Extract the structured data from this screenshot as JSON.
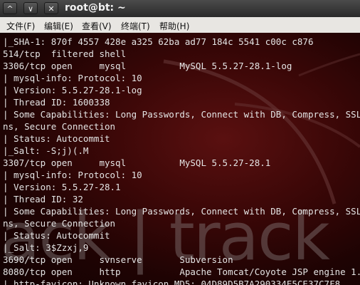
{
  "titlebar": {
    "title": "root@bt: ~",
    "buttons": [
      {
        "name": "scroll-up-button",
        "glyph": "^"
      },
      {
        "name": "minimize-button",
        "glyph": "∨"
      },
      {
        "name": "close-button",
        "glyph": "✕"
      }
    ]
  },
  "menubar": {
    "items": [
      "文件(F)",
      "编辑(E)",
      "查看(V)",
      "终端(T)",
      "帮助(H)"
    ]
  },
  "background": {
    "watermark": "ack | track"
  },
  "terminal": {
    "lines": [
      "|_SHA-1: 870f 4557 428e a325 62ba ad77 184c 5541 c00c c876",
      "514/tcp  filtered shell",
      "3306/tcp open     mysql          MySQL 5.5.27-28.1-log",
      "| mysql-info: Protocol: 10",
      "| Version: 5.5.27-28.1-log",
      "| Thread ID: 1600338",
      "| Some Capabilities: Long Passwords, Connect with DB, Compress, SSL, Transactio",
      "ns, Secure Connection",
      "| Status: Autocommit",
      "|_Salt: -S;j)(.M",
      "3307/tcp open     mysql          MySQL 5.5.27-28.1",
      "| mysql-info: Protocol: 10",
      "| Version: 5.5.27-28.1",
      "| Thread ID: 32",
      "| Some Capabilities: Long Passwords, Connect with DB, Compress, SSL, Transactio",
      "ns, Secure Connection",
      "| Status: Autocommit",
      "|_Salt: 3$Zzxj,9",
      "3690/tcp open     svnserve       Subversion",
      "8080/tcp open     http           Apache Tomcat/Coyote JSP engine 1.1",
      "|_http-favicon: Unknown favicon MD5: 04D89D5B7A290334E5CE37C7F8"
    ]
  }
}
